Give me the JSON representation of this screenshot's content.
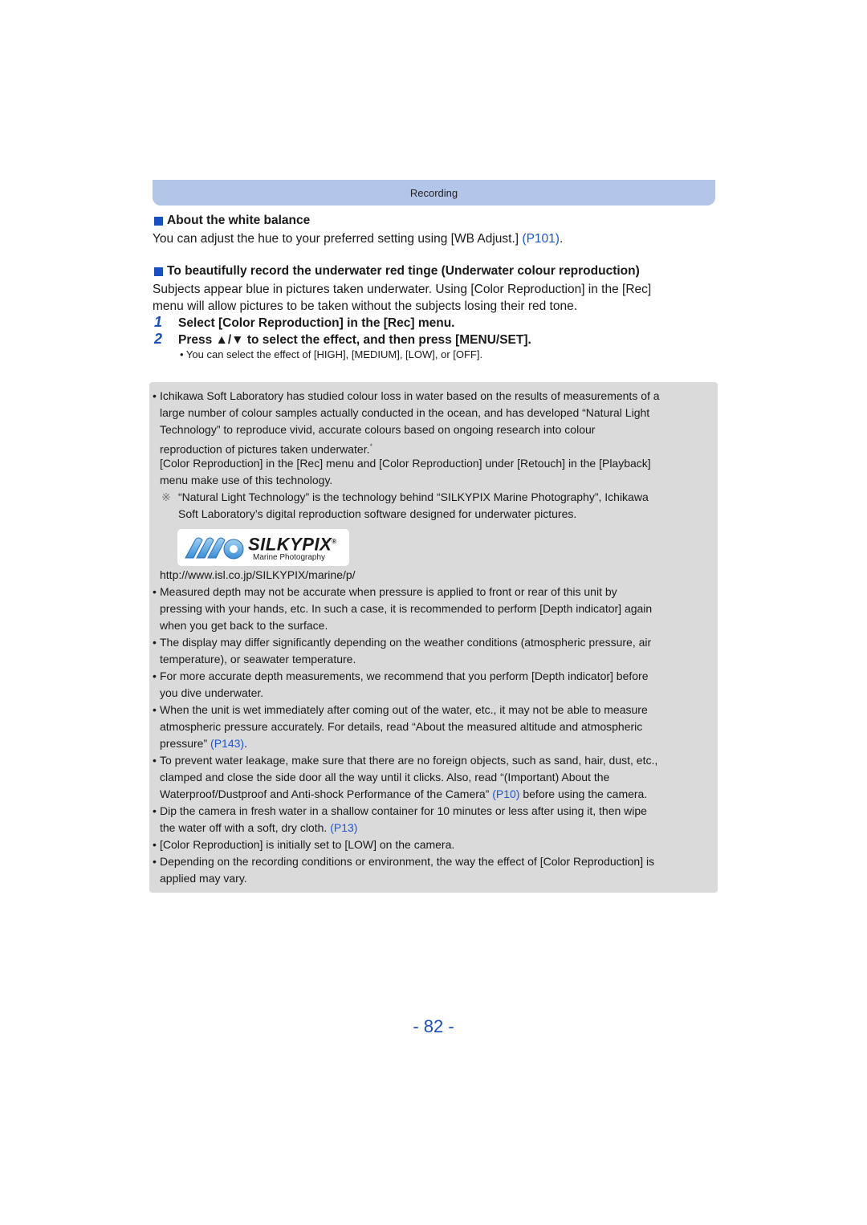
{
  "header": {
    "section": "Recording"
  },
  "white_balance": {
    "heading": "About the white balance",
    "text": "You can adjust the hue to your preferred setting using [WB Adjust.] ",
    "link": "(P101)",
    "after": "."
  },
  "underwater": {
    "heading": "To beautifully record the underwater red tinge (Underwater colour reproduction)",
    "lines": [
      "Subjects appear blue in pictures taken underwater. Using [Color Reproduction] in the [Rec]",
      "menu will allow pictures to be taken without the subjects losing their red tone."
    ],
    "steps": [
      {
        "num": "1",
        "text": "Select [Color Reproduction] in the [Rec] menu."
      },
      {
        "num": "2",
        "text": "Press ▲/▼ to select the effect, and then press [MENU/SET]."
      }
    ],
    "sub_bullet": "• You can select the effect of [HIGH], [MEDIUM], [LOW], or [OFF]."
  },
  "notes": {
    "bullet": "•",
    "ichikawa_lines": [
      "Ichikawa Soft Laboratory has studied colour loss in water based on the results of measurements of a",
      "large number of colour samples actually conducted in the ocean, and has developed “Natural Light",
      "Technology” to reproduce vivid, accurate colours based on ongoing research into colour",
      "reproduction of pictures taken underwater.",
      "[Color Reproduction] in the [Rec] menu and [Color Reproduction] under [Retouch] in the [Playback]",
      "menu make use of this technology."
    ],
    "asterisk": "*",
    "footnote_mark": "※",
    "footnote_lines": [
      "“Natural Light Technology” is the technology behind “SILKYPIX Marine Photography”, Ichikawa",
      "Soft Laboratory’s digital reproduction software designed for underwater pictures."
    ],
    "logo": {
      "brand": "SILKYPIX",
      "reg": "®",
      "subtitle": "Marine Photography"
    },
    "url": "http://www.isl.co.jp/SILKYPIX/marine/p/",
    "depth_lines": [
      "Measured depth may not be accurate when pressure is applied to front or rear of this unit by",
      "pressing with your hands, etc. In such a case, it is recommended to perform [Depth indicator] again",
      "when you get back to the surface."
    ],
    "display_lines": [
      "The display may differ significantly depending on the weather conditions (atmospheric pressure, air",
      "temperature), or seawater temperature."
    ],
    "accurate_lines": [
      "For more accurate depth measurements, we recommend that you perform [Depth indicator] before",
      "you dive underwater."
    ],
    "wet_lines": [
      "When the unit is wet immediately after coming out of the water, etc., it may not be able to measure",
      "atmospheric pressure accurately. For details, read “About the measured altitude and atmospheric"
    ],
    "wet_last": "pressure” ",
    "wet_link": "(P143)",
    "leak_lines": [
      "To prevent water leakage, make sure that there are no foreign objects, such as sand, hair, dust, etc.,",
      "clamped and close the side door all the way until it clicks. Also, read “(Important) About the"
    ],
    "leak_last": "Waterproof/Dustproof and Anti-shock Performance of the Camera” ",
    "leak_link": "(P10)",
    "leak_after": " before using the camera.",
    "dip_line": "Dip the camera in fresh water in a shallow container for 10 minutes or less after using it, then wipe",
    "dip_last": "the water off with a soft, dry cloth. ",
    "dip_link": "(P13)",
    "initial": "[Color Reproduction] is initially set to [LOW] on the camera.",
    "depending_lines": [
      "Depending on the recording conditions or environment, the way the effect of [Color Reproduction] is",
      "applied may vary."
    ]
  },
  "page_number": "- 82 -"
}
